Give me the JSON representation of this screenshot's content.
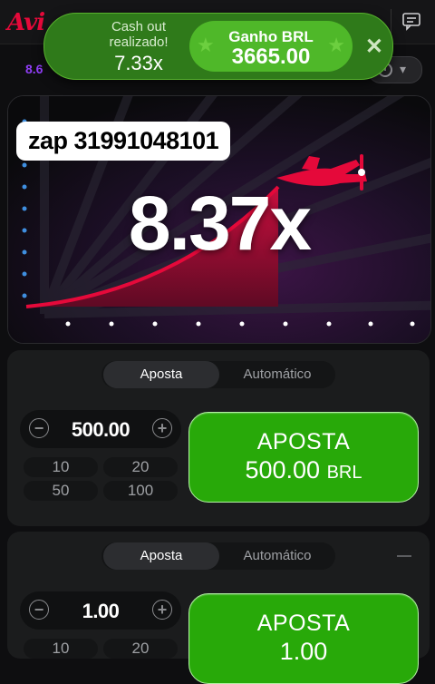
{
  "header": {
    "logo_text": "Avi"
  },
  "toast": {
    "label": "Cash out realizado!",
    "multiplier": "7.33x",
    "win_title": "Ganho BRL",
    "win_amount": "3665.00"
  },
  "history": {
    "first_value": "8.6"
  },
  "game": {
    "watermark": "zap 31991048101",
    "multiplier": "8.37x"
  },
  "panel1": {
    "tab_bet": "Aposta",
    "tab_auto": "Automático",
    "amount": "500.00",
    "quick": [
      "10",
      "20",
      "50",
      "100"
    ],
    "bet_label": "APOSTA",
    "bet_amount": "500.00",
    "bet_currency": "BRL"
  },
  "panel2": {
    "tab_bet": "Aposta",
    "tab_auto": "Automático",
    "amount": "1.00",
    "quick": [
      "10",
      "20"
    ],
    "bet_label": "APOSTA",
    "bet_amount": "1.00"
  },
  "colors": {
    "brand_red": "#e5093a",
    "bet_green": "#28a909",
    "history_purple": "#913ef8"
  }
}
